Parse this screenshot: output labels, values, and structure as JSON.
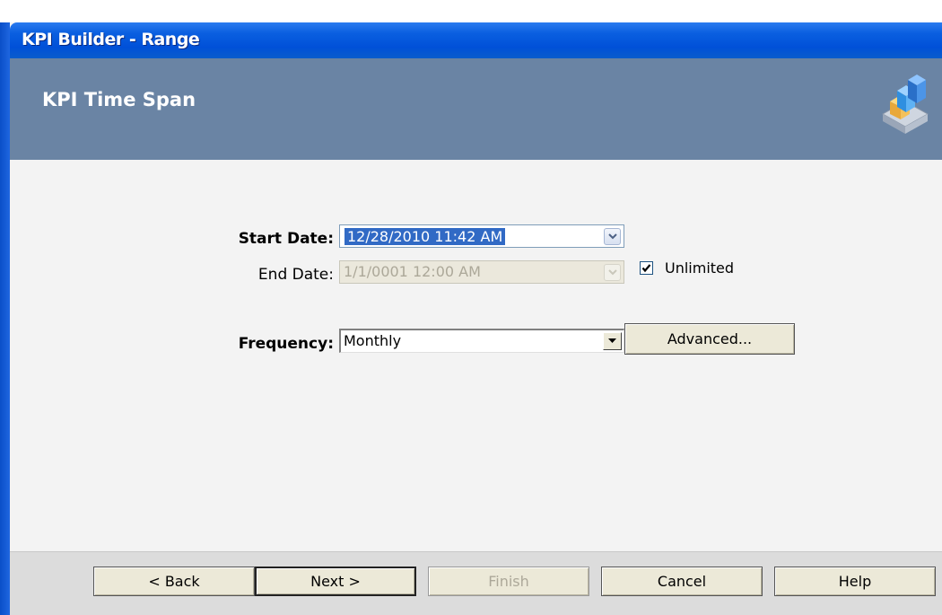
{
  "window": {
    "title": "KPI Builder - Range"
  },
  "header": {
    "heading": "KPI Time Span",
    "logo_icon": "kpi-builder-logo"
  },
  "form": {
    "start_date_label": "Start Date:",
    "start_date_value": "12/28/2010 11:42 AM",
    "end_date_label": "End Date:",
    "end_date_value": "1/1/0001 12:00 AM",
    "unlimited_label": "Unlimited",
    "unlimited_checked": true,
    "frequency_label": "Frequency:",
    "frequency_value": "Monthly",
    "advanced_label": "Advanced..."
  },
  "footer": {
    "back_label": "< Back",
    "next_label": "Next >",
    "finish_label": "Finish",
    "cancel_label": "Cancel",
    "help_label": "Help"
  },
  "colors": {
    "titlebar": "#0050d8",
    "header": "#6a84a4",
    "body": "#f3f3f3",
    "footer": "#dcdcdc",
    "selection": "#316ac5"
  }
}
